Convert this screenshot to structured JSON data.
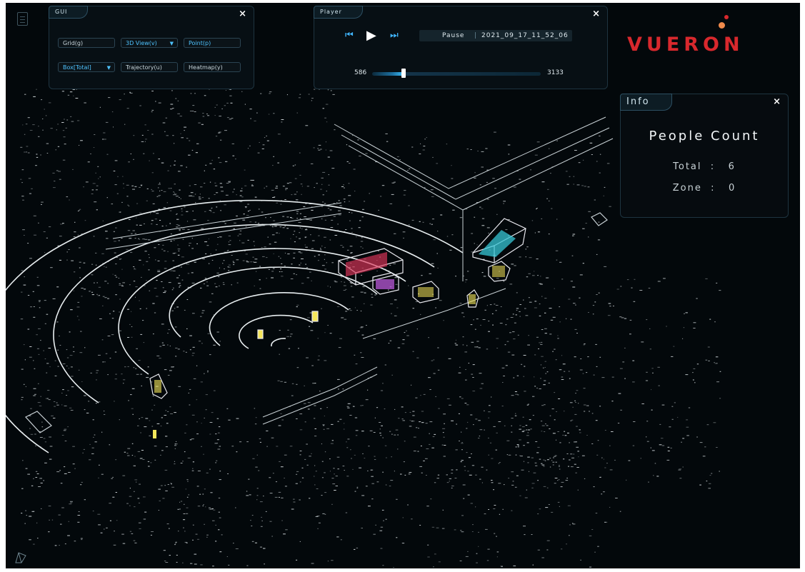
{
  "gui": {
    "title": "GUI",
    "close": "×",
    "grid": "Grid(g)",
    "view": "3D View(v)",
    "point": "Point(p)",
    "box": "Box[Total]",
    "trajectory": "Trajectory(u)",
    "heatmap": "Heatmap(y)",
    "dropdown_glyph": "▼"
  },
  "player": {
    "title": "Player",
    "close": "×",
    "prev": "⏮",
    "play": "▶",
    "next": "⏭",
    "state": "Pause",
    "separator": "|",
    "recording": "2021_09_17_11_52_06",
    "current_frame": "586",
    "total_frames": "3133",
    "progress_fraction": 0.187
  },
  "info": {
    "title": "Info",
    "close": "×",
    "heading": "People Count",
    "total_label": "Total",
    "total_value": "6",
    "zone_label": "Zone",
    "zone_value": "0",
    "colon": ":"
  },
  "brand": {
    "logo_text": "VUERON",
    "color": "#d8282d",
    "accent": "#f08a4b"
  },
  "colors": {
    "accent_blue": "#41b6ff",
    "box_yellow": "#f5e65a",
    "box_red": "#e0375c",
    "box_purple": "#c65ee6",
    "box_cyan": "#37c5d5"
  },
  "icons": {
    "side": "document-icon",
    "camera": "camera-frustum-icon"
  }
}
